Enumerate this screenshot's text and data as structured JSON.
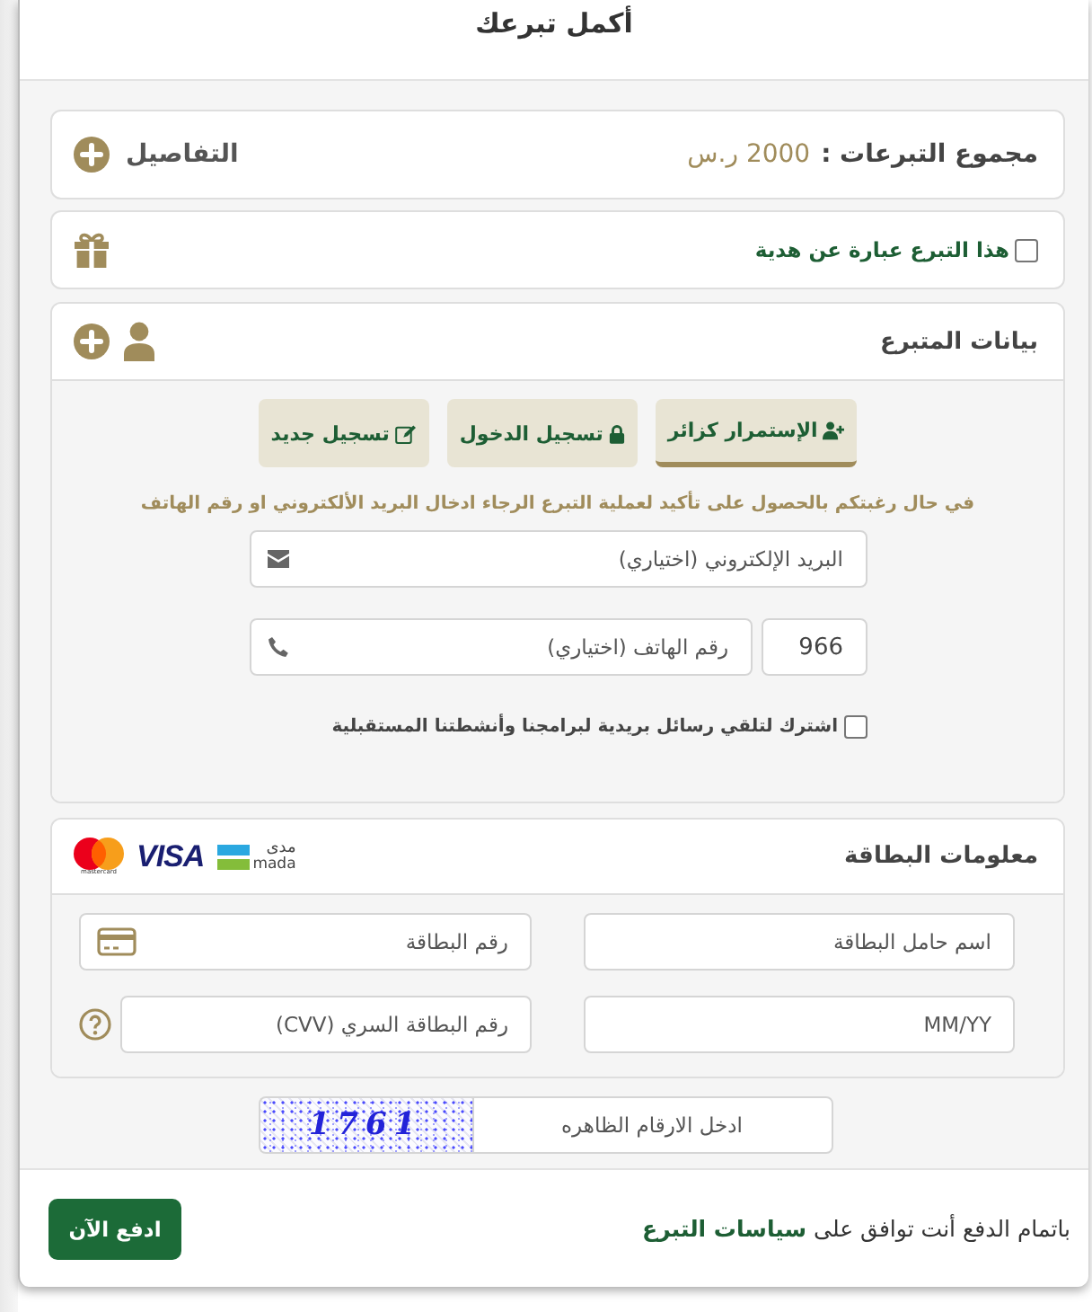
{
  "window": {
    "title": "أكمل تبرعك"
  },
  "summary": {
    "label": "مجموع التبرعات :",
    "amount": "2000 ر.س",
    "details": "التفاصيل"
  },
  "gift": {
    "label": "هذا التبرع عبارة عن هدية",
    "checked": false
  },
  "donor": {
    "title": "بيانات المتبرع",
    "tabs": [
      {
        "label": "الإستمرار كزائر",
        "kind": "guest",
        "selected": true
      },
      {
        "label": "تسجيل الدخول",
        "kind": "login",
        "selected": false
      },
      {
        "label": "تسجيل جديد",
        "kind": "register",
        "selected": false
      }
    ],
    "notice": "في حال رغبتكم بالحصول على تأكيد لعملية التبرع الرجاء ادخال البريد الألكتروني او رقم الهاتف",
    "email": {
      "placeholder": "البريد الإلكتروني (اختياري)"
    },
    "country_code": {
      "value": "966"
    },
    "phone": {
      "placeholder": "رقم الهاتف (اختياري)"
    },
    "newsletter": {
      "label": "اشترك لتلقي رسائل بريدية لبرامجنا وأنشطتنا المستقبلية",
      "checked": false
    }
  },
  "card": {
    "title": "معلومات البطاقة",
    "logos": [
      {
        "kind": "mada",
        "text_ar": "مدى",
        "text": "mada"
      },
      {
        "kind": "visa",
        "text": "VISA"
      },
      {
        "kind": "mastercard",
        "text": "mastercard"
      }
    ],
    "fields": [
      {
        "kind": "holder",
        "placeholder": "اسم حامل البطاقة"
      },
      {
        "kind": "number",
        "placeholder": "رقم البطاقة"
      },
      {
        "kind": "expiry",
        "placeholder": "MM/YY"
      },
      {
        "kind": "cvv",
        "placeholder": "رقم البطاقة السري (CVV)"
      }
    ]
  },
  "captcha": {
    "code": "1761",
    "placeholder": "ادخل الارقام الظاهره"
  },
  "footer": {
    "terms": "باتمام الدفع أنت توافق على",
    "link": "سياسات التبرع",
    "pay_button": "ادفع الآن"
  }
}
